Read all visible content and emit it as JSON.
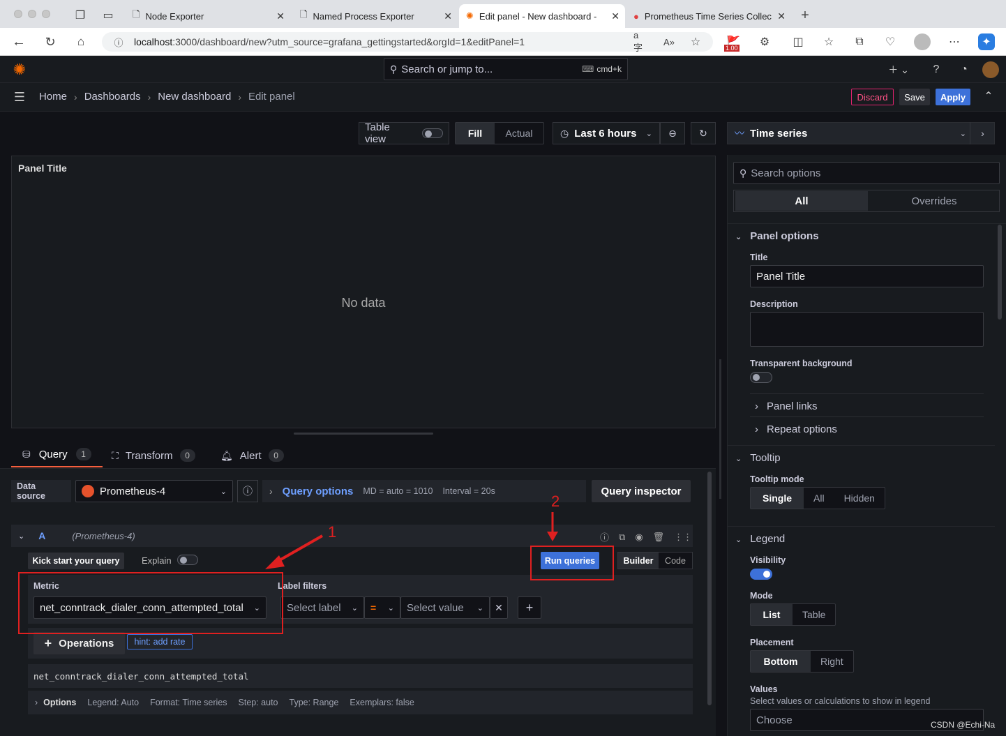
{
  "browser": {
    "tabs": [
      "Node Exporter",
      "Named Process Exporter",
      "Edit panel - New dashboard - I",
      "Prometheus Time Series Collec"
    ],
    "url_host": "localhost",
    "url_rest": ":3000/dashboard/new?utm_source=grafana_gettingstarted&orgId=1&editPanel=1",
    "ext_badge": "1.00"
  },
  "grafana": {
    "search_placeholder": "Search or jump to...",
    "search_shortcut": "cmd+k",
    "breadcrumb": [
      "Home",
      "Dashboards",
      "New dashboard",
      "Edit panel"
    ],
    "discard": "Discard",
    "save": "Save",
    "apply": "Apply"
  },
  "toolbar": {
    "table_view": "Table view",
    "fill": "Fill",
    "actual": "Actual",
    "time_range": "Last 6 hours"
  },
  "panel": {
    "title": "Panel Title",
    "no_data": "No data"
  },
  "query_tabs": [
    {
      "label": "Query",
      "count": "1"
    },
    {
      "label": "Transform",
      "count": "0"
    },
    {
      "label": "Alert",
      "count": "0"
    }
  ],
  "query": {
    "data_source_label": "Data source",
    "data_source": "Prometheus-4",
    "query_options": "Query options",
    "md": "MD = auto = 1010",
    "interval": "Interval = 20s",
    "inspector": "Query inspector",
    "ref": "A",
    "ref_ds": "(Prometheus-4)",
    "kick_start": "Kick start your query",
    "explain": "Explain",
    "run": "Run queries",
    "builder": "Builder",
    "code": "Code",
    "metric_label": "Metric",
    "metric": "net_conntrack_dialer_conn_attempted_total",
    "label_filters": "Label filters",
    "select_label": "Select label",
    "op": "=",
    "select_value": "Select value",
    "operations": "Operations",
    "hint": "hint: add rate",
    "preview": "net_conntrack_dialer_conn_attempted_total",
    "options_label": "Options",
    "legend": "Legend: Auto",
    "format": "Format: Time series",
    "step": "Step: auto",
    "type": "Type: Range",
    "exemplars": "Exemplars: false"
  },
  "annotations": {
    "one": "1",
    "two": "2"
  },
  "side": {
    "viz": "Time series",
    "search": "Search options",
    "all": "All",
    "overrides": "Overrides",
    "panel_options": "Panel options",
    "title_label": "Title",
    "title_value": "Panel Title",
    "description": "Description",
    "transparent": "Transparent background",
    "panel_links": "Panel links",
    "repeat": "Repeat options",
    "tooltip": "Tooltip",
    "tooltip_mode": "Tooltip mode",
    "single": "Single",
    "all_mode": "All",
    "hidden": "Hidden",
    "legend": "Legend",
    "visibility": "Visibility",
    "mode": "Mode",
    "list": "List",
    "table": "Table",
    "placement": "Placement",
    "bottom": "Bottom",
    "right": "Right",
    "values": "Values",
    "values_desc": "Select values or calculations to show in legend",
    "choose": "Choose"
  },
  "watermark": "CSDN @Echi-Na",
  "colors": {
    "accent": "#3d71d9",
    "discard": "#e0226e",
    "annotation": "#e02020",
    "orange": "#f46800"
  }
}
